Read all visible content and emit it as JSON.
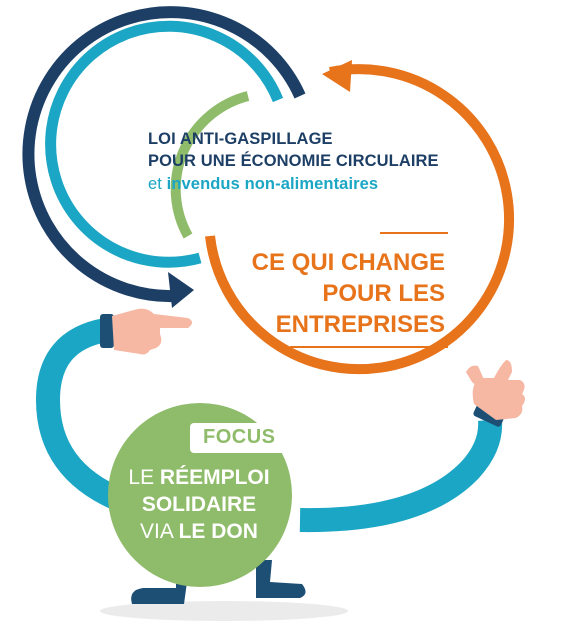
{
  "header": {
    "line1": "LOI ANTI-GASPILLAGE",
    "line2": "POUR UNE ÉCONOMIE CIRCULAIRE",
    "line3_prefix": "et",
    "line3_rest": "invendus non-alimentaires"
  },
  "change_block": {
    "line1": "CE QUI CHANGE",
    "line2": "POUR LES",
    "line3": "ENTREPRISES"
  },
  "focus_label": "FOCUS",
  "circle_text": {
    "line1_normal": "LE",
    "line1_bold": "RÉEMPLOI",
    "line2_bold": "SOLIDAIRE",
    "line3_normal": "VIA",
    "line3_bold": "LE DON"
  },
  "colors": {
    "navy": "#1d3f66",
    "teal": "#1aa6c4",
    "green": "#8fbc6a",
    "orange": "#e7731b",
    "skin": "#f6b7a3",
    "leg": "#1d4f75"
  }
}
